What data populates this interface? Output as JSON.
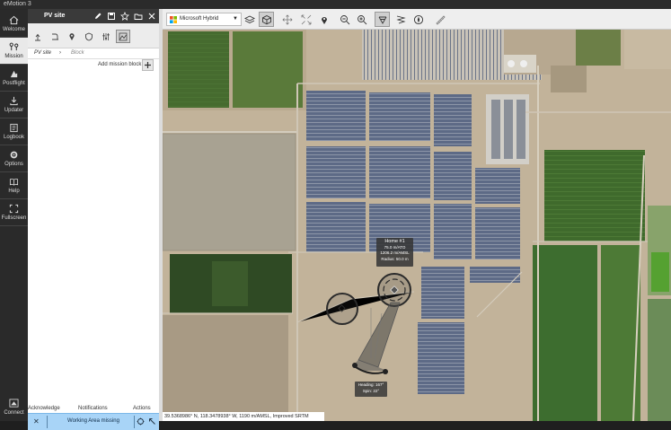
{
  "window": {
    "title": "eMotion 3"
  },
  "nav": {
    "items": [
      {
        "label": "Welcome",
        "icon": "home-icon"
      },
      {
        "label": "Mission",
        "icon": "mission-route-icon",
        "active": true
      },
      {
        "label": "Postflight",
        "icon": "postflight-icon"
      },
      {
        "label": "Updater",
        "icon": "download-icon"
      },
      {
        "label": "Logbook",
        "icon": "logbook-icon"
      },
      {
        "label": "Options",
        "icon": "gear-icon"
      },
      {
        "label": "Help",
        "icon": "book-icon"
      },
      {
        "label": "Fullscreen",
        "icon": "fullscreen-icon"
      }
    ],
    "connect_label": "Connect"
  },
  "panel": {
    "title": "PV site",
    "breadcrumb": {
      "site": "PV site",
      "block": "Block"
    },
    "add_block_label": "Add mission block"
  },
  "notifications": {
    "acknowledge_label": "Acknowledge",
    "notifications_label": "Notifications",
    "actions_label": "Actions",
    "message": "Working Area missing"
  },
  "map": {
    "layer": "Microsoft Hybrid",
    "coordinates": "39.5368986° N, 118.3478938° W, 1190 m/AMSL, Improved SRTM",
    "home": {
      "name": "Home #1",
      "height": "75.0 m/ATO",
      "elevation": "1206.2 m/AMSL",
      "radius": "Radius: 50.0 m"
    },
    "heading": {
      "heading": "Heading: 167°",
      "spin": "Spin: 22°"
    }
  },
  "colors": {
    "accent": "#a8d4f7",
    "dark": "#2a2a2a",
    "panel_header": "#3a3a3a"
  }
}
